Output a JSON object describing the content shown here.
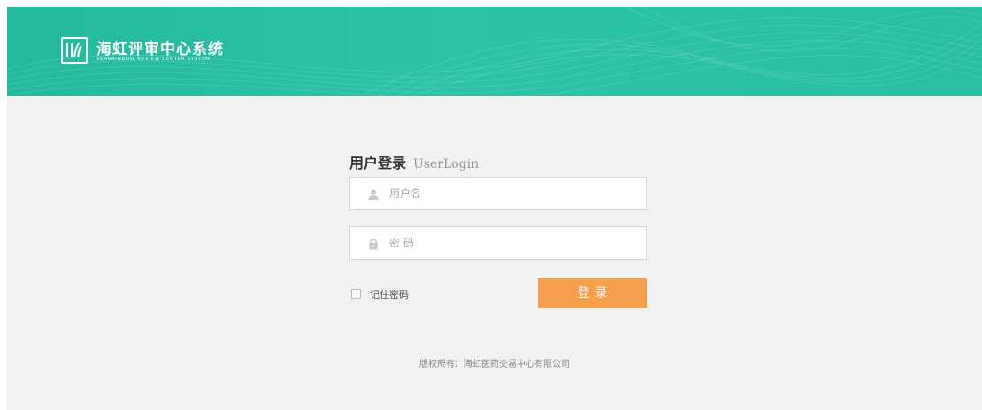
{
  "header": {
    "title": "海虹评审中心系统",
    "subtitle": "SEARAINBOW REVIEW CENTER SYSTEM",
    "logo_icon": "searainbow-logo-icon",
    "background_color": "#26bca0"
  },
  "login": {
    "heading_cn": "用户登录",
    "heading_en": "UserLogin",
    "username": {
      "placeholder": "用户名",
      "value": "",
      "icon": "user-icon"
    },
    "password": {
      "placeholder": "密 码",
      "value": "",
      "icon": "lock-icon"
    },
    "remember_label": "记住密码",
    "remember_checked": false,
    "submit_label": "登录",
    "submit_color": "#f6a04d"
  },
  "footer": {
    "copyright": "版权所有：海虹医药交易中心有限公司"
  }
}
